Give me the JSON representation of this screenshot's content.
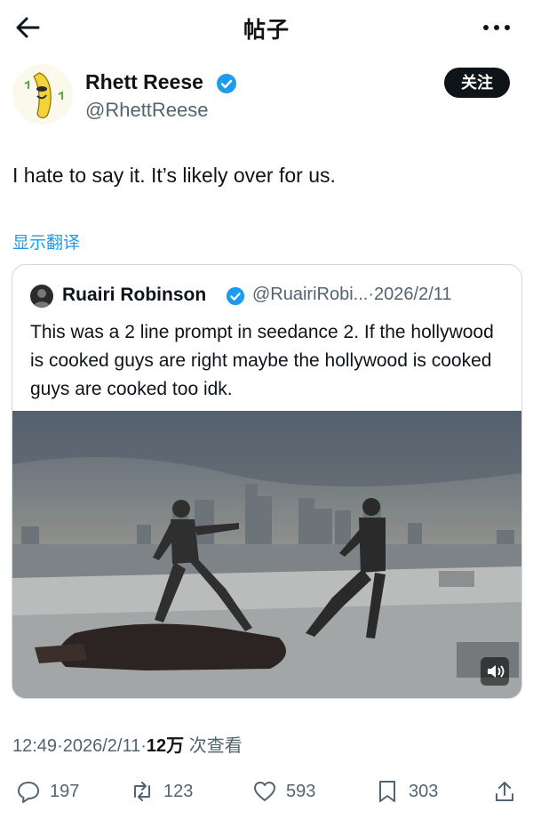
{
  "header": {
    "title": "帖子",
    "back_icon": "arrow-left-icon",
    "more_icon": "more-horizontal-icon"
  },
  "author": {
    "name": "Rhett Reese",
    "handle": "@RhettReese",
    "verified": true,
    "follow_label": "关注"
  },
  "tweet": {
    "text": "I hate to say it. It’s likely over for us.",
    "translate_label": "显示翻译"
  },
  "quoted": {
    "name": "Ruairi Robinson",
    "handle": "@RuairiRobi...",
    "date_sep": "·",
    "date": "2026/2/11",
    "verified": true,
    "text": "This was a 2 line prompt in seedance 2. If the hollywood is cooked guys are right maybe the hollywood is cooked guys are cooked too idk.",
    "media_icon": "volume-icon"
  },
  "meta": {
    "time": "12:49",
    "sep": "·",
    "date": "2026/2/11",
    "views_count": "12万",
    "views_label": "次查看"
  },
  "actions": {
    "reply_count": "197",
    "retweet_count": "123",
    "like_count": "593",
    "bookmark_count": "303"
  },
  "colors": {
    "link": "#1d9bf0",
    "text": "#0f1419",
    "secondary": "#536471",
    "follow_bg": "#0f1419",
    "verified": "#1d9bf0"
  }
}
